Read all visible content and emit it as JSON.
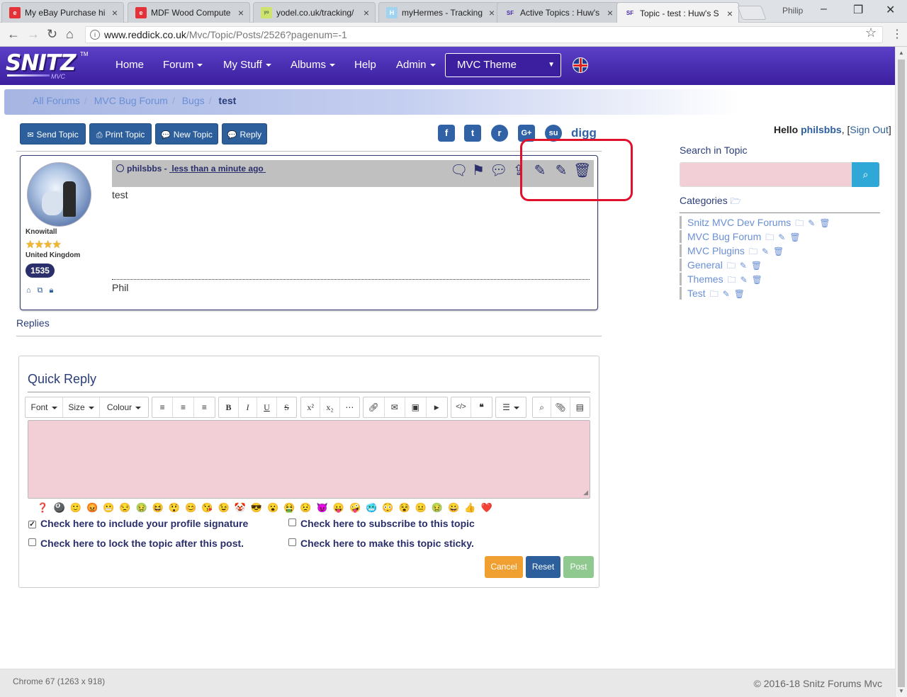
{
  "browser": {
    "tabs": [
      {
        "title": "My eBay Purchase hi",
        "favicon": "eBay"
      },
      {
        "title": "MDF Wood Compute",
        "favicon": "eBay"
      },
      {
        "title": "yodel.co.uk/tracking/",
        "favicon": "yodel"
      },
      {
        "title": "myHermes - Tracking",
        "favicon": "H"
      },
      {
        "title": "Active Topics : Huw's",
        "favicon": "SF"
      },
      {
        "title": "Topic - test : Huw's S",
        "favicon": "SF"
      }
    ],
    "profile_name": "Philip",
    "url_host": "www.reddick.co.uk",
    "url_path": "/Mvc/Topic/Posts/2526?pagenum=-1"
  },
  "site": {
    "logo_text": "SNITZ",
    "logo_sub": "MVC",
    "logo_tm": "TM",
    "nav": [
      {
        "label": "Home",
        "dropdown": false
      },
      {
        "label": "Forum",
        "dropdown": true
      },
      {
        "label": "My Stuff",
        "dropdown": true
      },
      {
        "label": "Albums",
        "dropdown": true
      },
      {
        "label": "Help",
        "dropdown": false
      },
      {
        "label": "Admin",
        "dropdown": true
      }
    ],
    "theme_select": "MVC Theme",
    "colors": {
      "navbar": "#3b1f9e",
      "button": "#2c5f9b",
      "highlight": "#e0112b"
    }
  },
  "breadcrumb": [
    "All Forums",
    "MVC Bug Forum",
    "Bugs",
    "test"
  ],
  "actions": {
    "send_topic": "Send Topic",
    "print_topic": "Print Topic",
    "new_topic": "New Topic",
    "reply": "Reply"
  },
  "social": [
    "facebook-icon",
    "twitter-icon",
    "reddit-icon",
    "google-plus-icon",
    "stumbleupon-icon",
    "digg-icon"
  ],
  "greeting": {
    "prefix": "Hello",
    "user": "philsbbs",
    "sign_out": "Sign Out"
  },
  "post": {
    "author": "philsbbs",
    "time": "less than a minute ago",
    "rank": "Knowitall",
    "stars": 4,
    "country": "United Kingdom",
    "post_count": "1535",
    "body": "test",
    "signature": "Phil",
    "action_icons": [
      "reply-quote-icon",
      "bookmark-icon",
      "comment-icon",
      "share-icon",
      "edit-icon",
      "edit-icon",
      "delete-icon"
    ]
  },
  "replies_label": "Replies",
  "quick_reply": {
    "title": "Quick Reply",
    "toolbar": {
      "font": "Font",
      "size": "Size",
      "colour": "Colour"
    },
    "options": {
      "signature": "Check here to include your profile signature",
      "subscribe": "Check here to subscribe to this topic",
      "lock": "Check here to lock the topic after this post.",
      "sticky": "Check here to make this topic sticky."
    },
    "signature_checked": true,
    "buttons": {
      "cancel": "Cancel",
      "reset": "Reset",
      "post": "Post"
    }
  },
  "sidebar": {
    "search_title": "Search in Topic",
    "categories_title": "Categories",
    "categories": [
      "Snitz MVC Dev Forums",
      "MVC Bug Forum",
      "MVC Plugins",
      "General",
      "Themes",
      "Test"
    ]
  },
  "footer": {
    "left": "Chrome 67 (1263 x 918)",
    "right": "© 2016-18 Snitz Forums Mvc"
  }
}
